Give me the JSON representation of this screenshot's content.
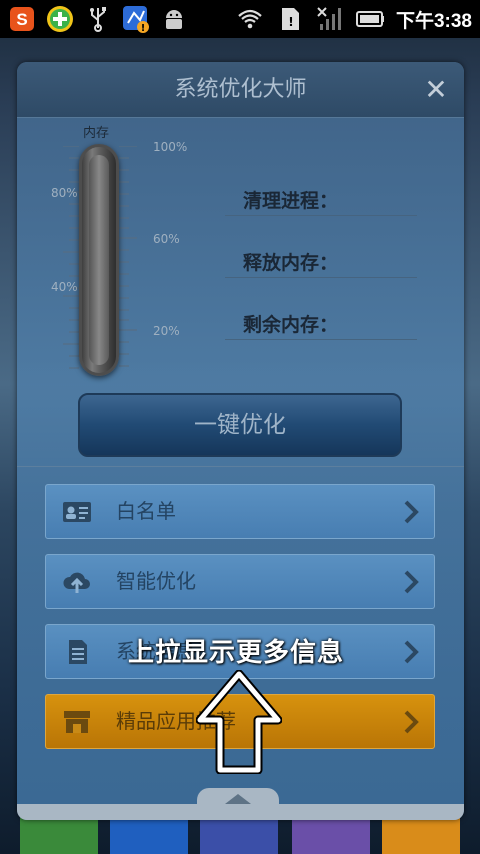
{
  "status_bar": {
    "time": "下午3:38",
    "left_icons": [
      "sogou-input-icon",
      "plus-app-icon",
      "usb-icon",
      "sync-warning-icon",
      "android-debug-icon"
    ],
    "right_icons": [
      "wifi-icon",
      "sim-card-icon",
      "signal-icon",
      "battery-icon"
    ]
  },
  "dialog": {
    "title": "系统优化大师",
    "close": "✕",
    "gauge": {
      "label": "内存",
      "ticks_left": [
        "80%",
        "40%"
      ],
      "ticks_right": [
        "100%",
        "60%",
        "20%"
      ]
    },
    "info": {
      "clean_process": "清理进程：",
      "free_memory": "释放内存：",
      "remaining_memory": "剩余内存："
    },
    "optimize_button": "一键优化",
    "menu": [
      {
        "label": "白名单",
        "icon": "id-card-icon"
      },
      {
        "label": "智能优化",
        "icon": "cloud-upload-icon"
      },
      {
        "label": "系统信息",
        "icon": "document-icon"
      },
      {
        "label": "精品应用推荐",
        "icon": "store-icon"
      }
    ]
  },
  "hint": {
    "text": "上拉显示更多信息"
  },
  "colors": {
    "featured": "#d7920e",
    "menu_bg": "#5e96c8",
    "header": "#2e4a66"
  }
}
